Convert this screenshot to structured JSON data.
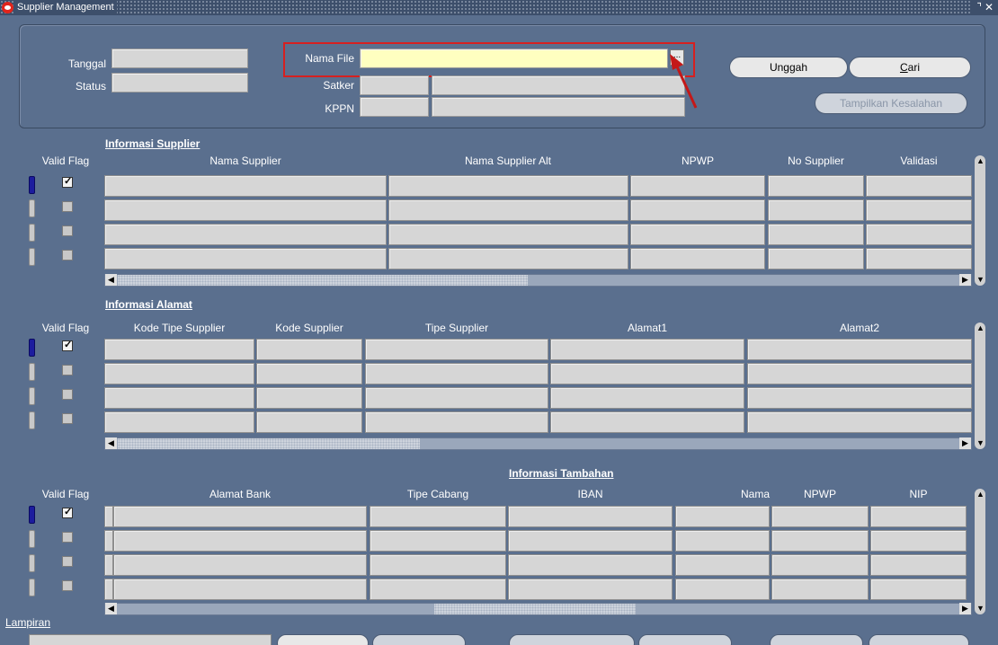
{
  "window": {
    "title": "Supplier Management",
    "controls": "⌝✕"
  },
  "header": {
    "tanggal_label": "Tanggal",
    "status_label": "Status",
    "nama_file_label": "Nama File",
    "satker_label": "Satker",
    "kppn_label": "KPPN",
    "lov_label": "...",
    "unggah_button": "Unggah",
    "cari_button": "Cari",
    "tampilkan_kesalahan_button": "Tampilkan Kesalahan"
  },
  "supplier_section": {
    "title": "Informasi Supplier",
    "valid_flag_header": "Valid Flag",
    "columns": [
      "Nama Supplier",
      "Nama Supplier Alt",
      "NPWP",
      "No Supplier",
      "Validasi"
    ],
    "row_checked": [
      true,
      false,
      false,
      false
    ]
  },
  "alamat_section": {
    "title": "Informasi Alamat",
    "valid_flag_header": "Valid Flag",
    "columns": [
      "Kode Tipe Supplier",
      "Kode Supplier",
      "Tipe Supplier",
      "Alamat1",
      "Alamat2"
    ],
    "row_checked": [
      true,
      false,
      false,
      false
    ]
  },
  "tambahan_section": {
    "title": "Informasi Tambahan",
    "valid_flag_header": "Valid Flag",
    "columns": [
      "Alamat Bank",
      "Tipe Cabang",
      "IBAN",
      "Nama",
      "NPWP",
      "NIP"
    ],
    "row_checked": [
      true,
      false,
      false,
      false
    ]
  },
  "footer": {
    "lampiran_label": "Lampiran"
  },
  "colors": {
    "background": "#5a6f8e",
    "highlight": "#d62020",
    "active_row": "#1c1c9e",
    "file_field": "#ffffc0"
  }
}
